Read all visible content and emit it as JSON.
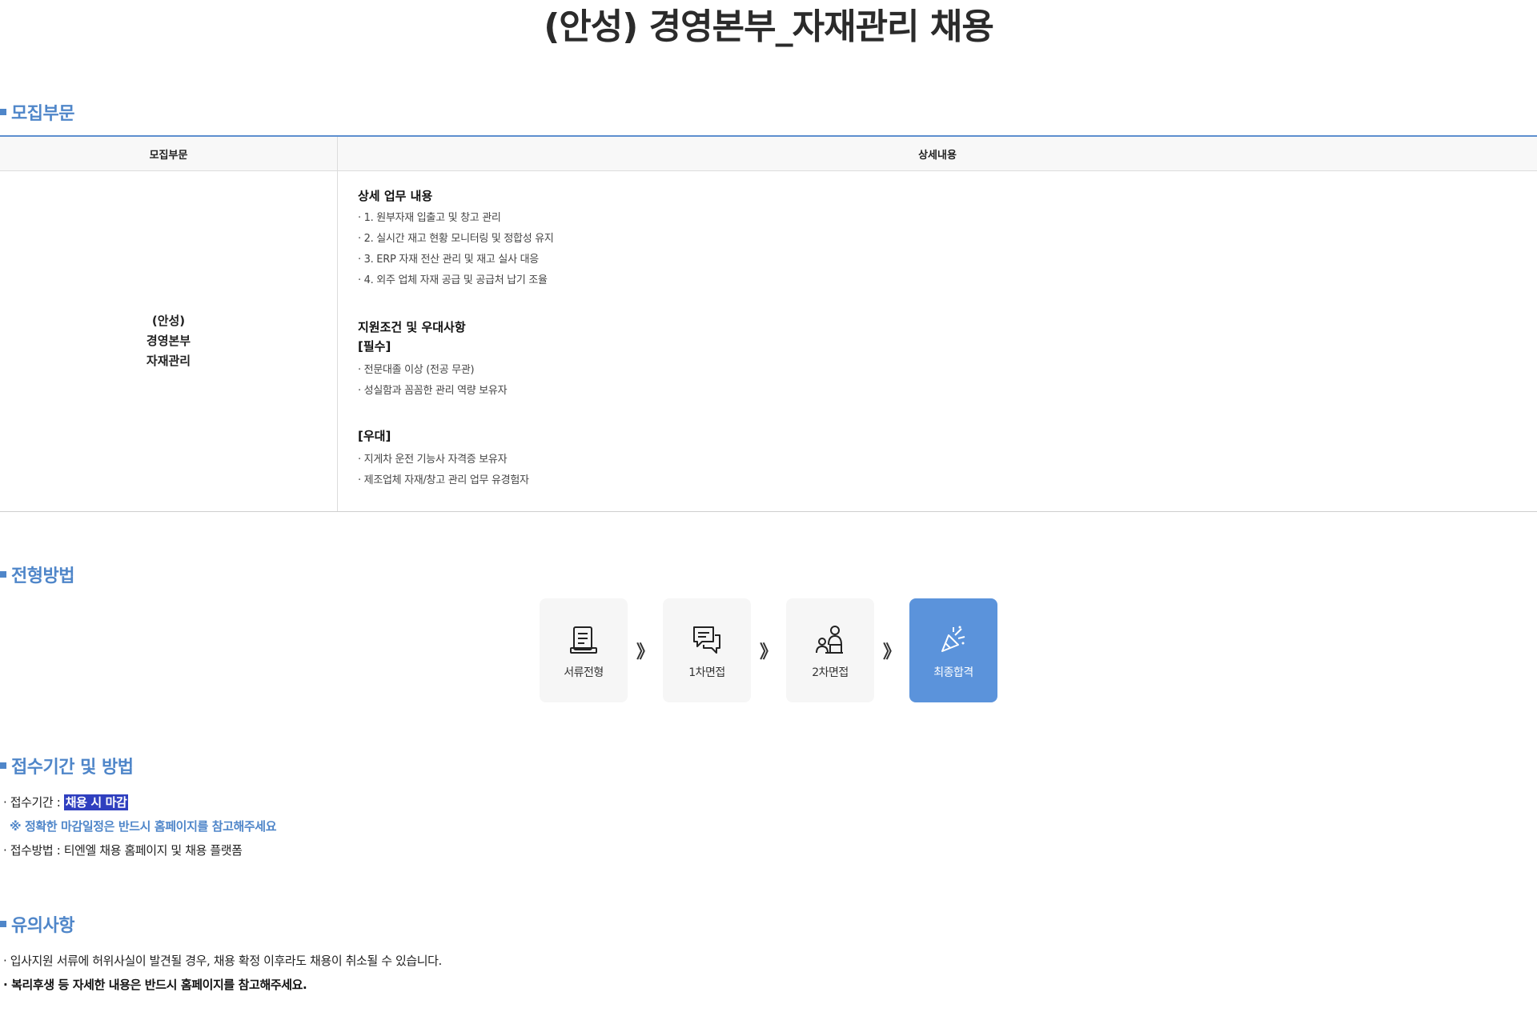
{
  "page": {
    "title": "(안성) 경영본부_자재관리 채용"
  },
  "sections": {
    "recruit": "모집부문",
    "process": "전형방법",
    "apply": "접수기간 및 방법",
    "notes": "유의사항"
  },
  "table": {
    "headers": [
      "모집부문",
      "상세내용"
    ],
    "department": [
      "(안성)",
      "경영본부",
      "자재관리"
    ],
    "duties": {
      "title": "상세 업무 내용",
      "items": [
        "· 1. 원부자재 입출고 및 창고 관리",
        "· 2. 실시간 재고 현황 모니터링 및 정합성 유지",
        "· 3. ERP 자재 전산 관리 및 재고 실사 대응",
        "· 4. 외주 업체 자재 공급 및 공급처 납기 조율"
      ]
    },
    "qualifications": {
      "title": "지원조건 및 우대사항",
      "required_label": "[필수]",
      "required": [
        "· 전문대졸 이상 (전공 무관)",
        "· 성실함과 꼼꼼한 관리 역량 보유자"
      ],
      "preferred_label": "[우대]",
      "preferred": [
        "· 지게차 운전 기능사 자격증 보유자",
        "· 제조업체 자재/창고 관리 업무 유경험자"
      ]
    }
  },
  "process": {
    "steps": [
      {
        "label": "서류전형",
        "icon": "document-icon"
      },
      {
        "label": "1차면접",
        "icon": "chat-bubbles-icon"
      },
      {
        "label": "2차면접",
        "icon": "interview-people-icon"
      },
      {
        "label": "최종합격",
        "icon": "party-popper-icon"
      }
    ],
    "arrow": "》",
    "final_color": "#5b93db"
  },
  "apply": {
    "period_label": "· 접수기간 : ",
    "period_value": "채용 시 마감",
    "notice": "※ 정확한 마감일정은 반드시 홈페이지를 참고해주세요",
    "method": "· 접수방법 : 티엔엘 채용 홈페이지 및 채용 플랫폼"
  },
  "notes": {
    "items": [
      "· 입사지원 서류에 허위사실이 발견될 경우, 채용 확정 이후라도 채용이 취소될 수 있습니다.",
      "· 복리후생 등 자세한 내용은 반드시 홈페이지를 참고해주세요."
    ]
  },
  "colors": {
    "accent": "#4f86c9",
    "highlight": "#2f3fbf"
  }
}
